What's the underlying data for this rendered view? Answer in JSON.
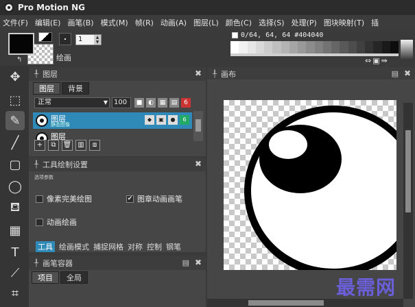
{
  "window": {
    "title": "Pro Motion NG"
  },
  "menu": [
    "文件(F)",
    "编辑(E)",
    "画笔(B)",
    "模式(M)",
    "帧(R)",
    "动画(A)",
    "图层(L)",
    "颜色(C)",
    "选择(S)",
    "处理(P)",
    "图块映射(T)",
    "插"
  ],
  "toolbar": {
    "brush_size": "1",
    "draw_label": "绘画",
    "color_info": "0/64, 64, 64 #404040"
  },
  "palette": [
    "#ffffff",
    "#f2f2f2",
    "#e6e6e6",
    "#d9d9d9",
    "#cccccc",
    "#bfbfbf",
    "#b3b3b3",
    "#a6a6a6",
    "#999999",
    "#8c8c8c",
    "#808080",
    "#737373",
    "#666666",
    "#595959",
    "#4d4d4d",
    "#404040",
    "#333333",
    "#262626",
    "#1a1a1a",
    "#0d0d0d"
  ],
  "layers_panel": {
    "title": "图层",
    "tabs": [
      "图层",
      "背景"
    ],
    "blend_mode": "正常",
    "opacity": "100",
    "layers": [
      {
        "name": "图层",
        "sub": "静态图像",
        "selected": true
      },
      {
        "name": "图层",
        "sub": "",
        "selected": false
      }
    ]
  },
  "canvas_panel": {
    "title": "画布"
  },
  "tool_settings": {
    "title": "工具绘制设置",
    "section_label": "选项参数",
    "options": [
      {
        "label": "像素完美绘图",
        "checked": false
      },
      {
        "label": "图章动画画笔",
        "checked": true
      },
      {
        "label": "动画绘画",
        "checked": false
      }
    ],
    "tabs": [
      "工具",
      "绘画模式",
      "捕捉网格",
      "对称",
      "控制",
      "钢笔"
    ]
  },
  "brush_container": {
    "title": "画笔容器",
    "tabs": [
      "项目",
      "全局"
    ]
  },
  "watermark": "最需网",
  "icons": {
    "swap": "↰",
    "close": "✖",
    "pin": "╀",
    "checkmark": "✔"
  }
}
